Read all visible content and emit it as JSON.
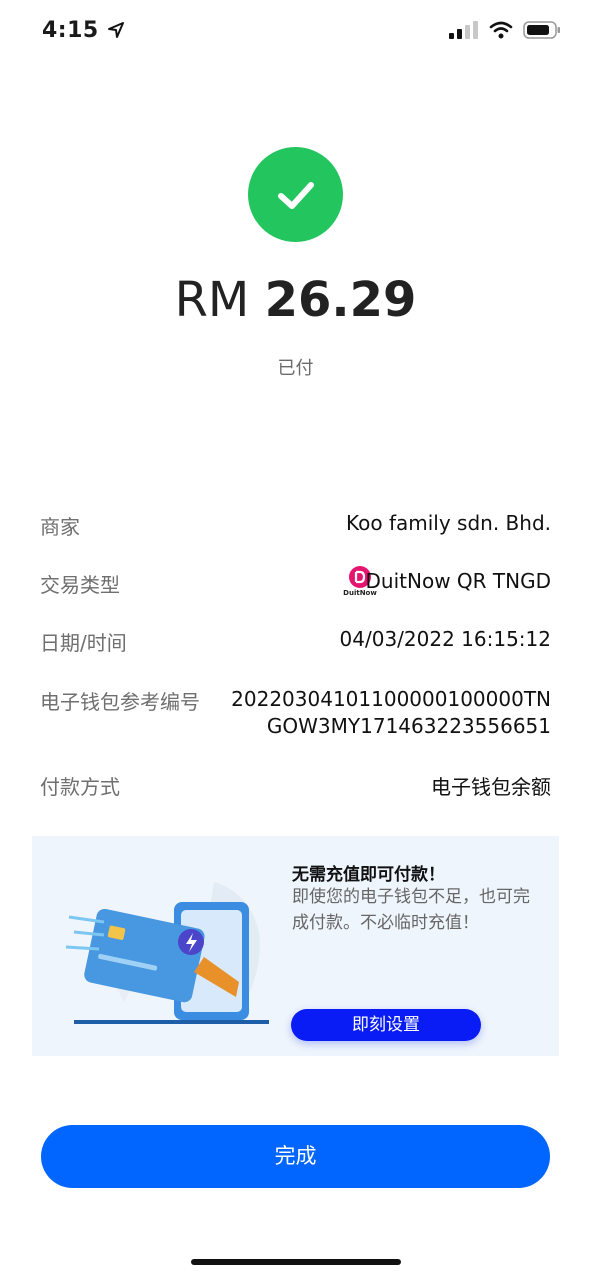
{
  "status_bar": {
    "time": "4:15"
  },
  "payment": {
    "currency": "RM",
    "amount": "26.29",
    "status": "已付"
  },
  "details": {
    "merchant": {
      "label": "商家",
      "value": "Koo family sdn. Bhd."
    },
    "transaction_type": {
      "label": "交易类型",
      "value": "DuitNow QR TNGD",
      "logo_text": "DuitNow"
    },
    "datetime": {
      "label": "日期/时间",
      "value": "04/03/2022 16:15:12"
    },
    "reference": {
      "label": "电子钱包参考编号",
      "value": "20220304101100000100000TNGOW3MY171463223556651"
    },
    "payment_method": {
      "label": "付款方式",
      "value": "电子钱包余额"
    }
  },
  "promo": {
    "title": "无需充值即可付款！",
    "description": "即使您的电子钱包不足，也可完成付款。不必临时充值！",
    "button": "即刻设置"
  },
  "done_button": "完成",
  "colors": {
    "success": "#22c55e",
    "primary": "#0066ff",
    "promo_button": "#0a1cf5",
    "duitnow": "#e5156f"
  }
}
